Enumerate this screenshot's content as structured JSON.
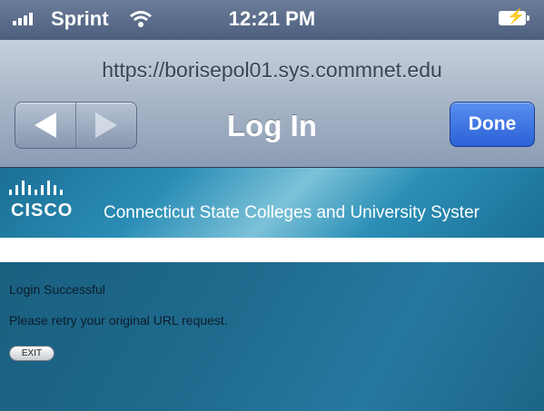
{
  "status_bar": {
    "carrier": "Sprint",
    "time": "12:21 PM",
    "signal_icon": "signal-bars-icon",
    "wifi_icon": "wifi-icon",
    "battery_icon": "battery-charging-icon"
  },
  "browser": {
    "url": "https://borisepol01.sys.commnet.edu",
    "title": "Log In",
    "back_icon": "back-arrow-icon",
    "forward_icon": "forward-arrow-icon",
    "done_label": "Done",
    "done_color": "#2a61d6"
  },
  "banner": {
    "logo_text": "CISCO",
    "title": "Connecticut State Colleges and University Syster"
  },
  "content": {
    "message": "Login Successful",
    "instruction": "Please retry your original URL request.",
    "exit_label": "EXIT"
  }
}
